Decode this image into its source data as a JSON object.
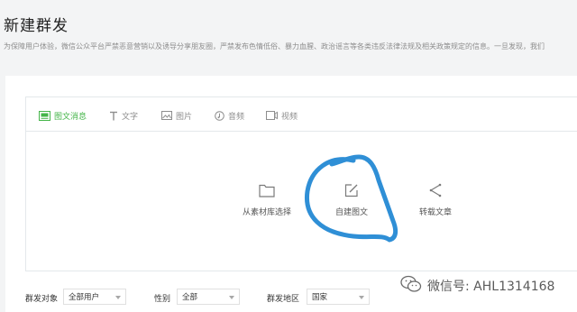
{
  "page": {
    "title": "新建群发",
    "notice": "为保障用户体验，微信公众平台严禁恶意营销以及诱导分享朋友圈，严禁发布色情低俗、暴力血腥、政治谣言等各类违反法律法规及相关政策规定的信息。一旦发现，我们"
  },
  "tabs": [
    {
      "label": "图文消息",
      "icon": "news-icon",
      "active": true
    },
    {
      "label": "文字",
      "icon": "text-icon"
    },
    {
      "label": "图片",
      "icon": "image-icon"
    },
    {
      "label": "音频",
      "icon": "audio-icon"
    },
    {
      "label": "视频",
      "icon": "video-icon"
    }
  ],
  "actions": [
    {
      "label": "从素材库选择",
      "icon": "folder-icon"
    },
    {
      "label": "自建图文",
      "icon": "edit-icon"
    },
    {
      "label": "转载文章",
      "icon": "share-icon"
    }
  ],
  "filters": {
    "target_label": "群发对象",
    "target_value": "全部用户",
    "gender_label": "性别",
    "gender_value": "全部",
    "region_label": "群发地区",
    "region_value": "国家"
  },
  "watermark": {
    "text": "微信号: AHL1314168",
    "icon": "wechat-icon"
  },
  "colors": {
    "accent": "#44b549",
    "annotation_ink": "#2f8fd6",
    "muted": "#8d8d8d"
  }
}
